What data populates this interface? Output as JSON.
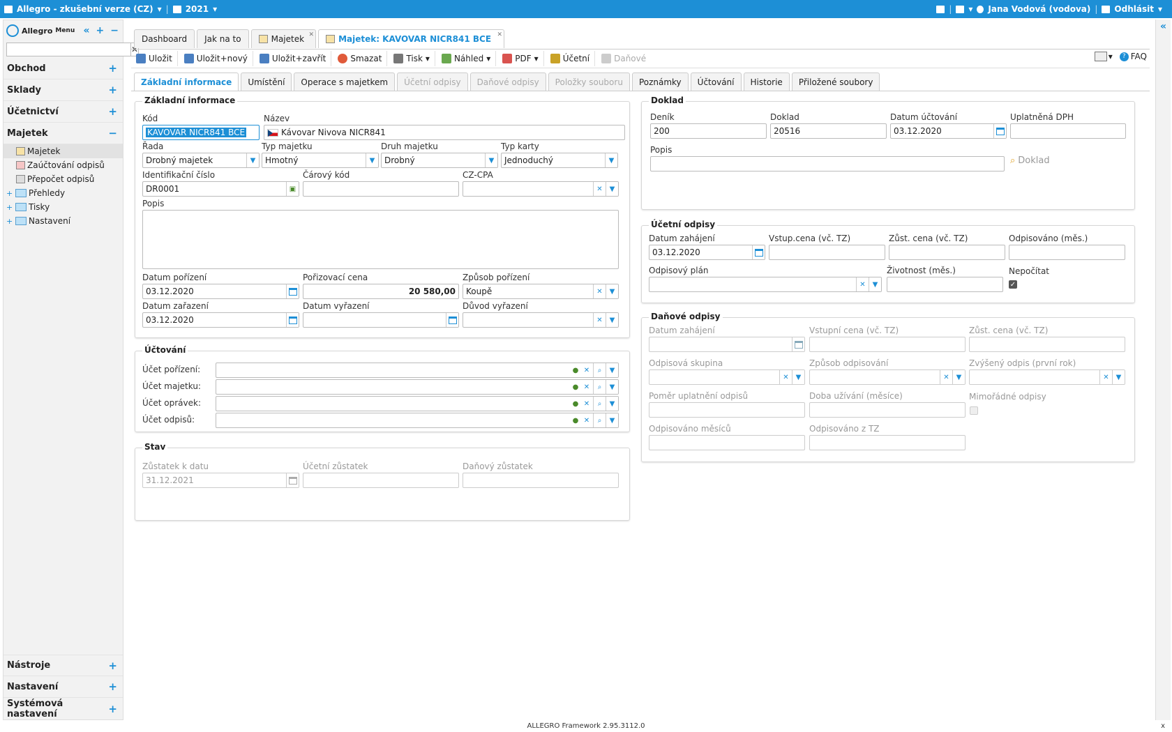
{
  "topbar": {
    "app_title": "Allegro - zkušební verze (CZ)",
    "year": "2021",
    "user": "Jana Vodová (vodova)",
    "logout": "Odhlásit"
  },
  "sidebar": {
    "brand": "Allegro",
    "brand_sub": "Menu",
    "search_placeholder": "",
    "sections": {
      "obchod": "Obchod",
      "sklady": "Sklady",
      "ucetnictvi": "Účetnictví",
      "majetek": "Majetek",
      "nastroje": "Nástroje",
      "nastaveni": "Nastavení",
      "systemova": "Systémová nastavení"
    },
    "items": {
      "majetek": "Majetek",
      "zauctovani": "Zaúčtování odpisů",
      "prepocet": "Přepočet odpisů",
      "prehledy": "Přehledy",
      "tisky": "Tisky",
      "nastaveni": "Nastavení"
    }
  },
  "tabs": {
    "dashboard": "Dashboard",
    "jak": "Jak na to",
    "majetek": "Majetek",
    "detail": "Majetek: KAVOVAR NICR841 BCE"
  },
  "toolbar": {
    "ulozit": "Uložit",
    "ulozit_novy": "Uložit+nový",
    "ulozit_zavrit": "Uložit+zavřít",
    "smazat": "Smazat",
    "tisk": "Tisk",
    "nahled": "Náhled",
    "pdf": "PDF",
    "ucetni": "Účetní",
    "danove": "Daňové",
    "faq": "FAQ"
  },
  "form_tabs": {
    "zakladni": "Základní informace",
    "umisteni": "Umístění",
    "operace": "Operace s majetkem",
    "ucetni_odpisy": "Účetní odpisy",
    "danove_odpisy": "Daňové odpisy",
    "polozky": "Položky souboru",
    "poznamky": "Poznámky",
    "uctovani": "Účtování",
    "historie": "Historie",
    "prilozene": "Přiložené soubory"
  },
  "basic": {
    "legend": "Základní informace",
    "kod_label": "Kód",
    "kod": "KAVOVAR NICR841 BCE",
    "nazev_label": "Název",
    "nazev": "Kávovar Nivova NICR841",
    "rada_label": "Řada",
    "rada": "Drobný majetek",
    "typ_label": "Typ majetku",
    "typ": "Hmotný",
    "druh_label": "Druh majetku",
    "druh": "Drobný",
    "karta_label": "Typ karty",
    "karta": "Jednoduchý",
    "ic_label": "Identifikační číslo",
    "ic": "DR0001",
    "carovy_label": "Čárový kód",
    "carovy": "",
    "cpa_label": "CZ-CPA",
    "cpa": "",
    "popis_label": "Popis",
    "popis": "",
    "datum_por_label": "Datum pořízení",
    "datum_por": "03.12.2020",
    "cena_label": "Pořizovací cena",
    "cena": "20 580,00",
    "zpusob_label": "Způsob pořízení",
    "zpusob": "Koupě",
    "datum_zar_label": "Datum zařazení",
    "datum_zar": "03.12.2020",
    "datum_vyr_label": "Datum vyřazení",
    "datum_vyr": "",
    "duvod_label": "Důvod vyřazení",
    "duvod": ""
  },
  "uctovani": {
    "legend": "Účtování",
    "porizeni": "Účet pořízení:",
    "majetku": "Účet majetku:",
    "opravek": "Účet oprávek:",
    "odpisu": "Účet odpisů:"
  },
  "stav": {
    "legend": "Stav",
    "zustatek_label": "Zůstatek k datu",
    "zustatek": "31.12.2021",
    "ucetni_label": "Účetní zůstatek",
    "danovy_label": "Daňový zůstatek"
  },
  "doklad": {
    "legend": "Doklad",
    "denik_label": "Deník",
    "denik": "200",
    "doklad_label": "Doklad",
    "doklad": "20516",
    "datum_label": "Datum účtování",
    "datum": "03.12.2020",
    "dph_label": "Uplatněná DPH",
    "popis_label": "Popis",
    "doklad_btn": "Doklad"
  },
  "ucetni_odpisy": {
    "legend": "Účetní odpisy",
    "zahajeni_label": "Datum zahájení",
    "zahajeni": "03.12.2020",
    "vstup_label": "Vstup.cena (vč. TZ)",
    "zust_label": "Zůst. cena (vč. TZ)",
    "odpisovano_label": "Odpisováno (měs.)",
    "plan_label": "Odpisový plán",
    "zivotnost_label": "Životnost (měs.)",
    "nepocitat_label": "Nepočítat"
  },
  "danove_odpisy": {
    "legend": "Daňové odpisy",
    "zahajeni_label": "Datum zahájení",
    "vstup_label": "Vstupní cena (vč. TZ)",
    "zust_label": "Zůst. cena (vč. TZ)",
    "skupina_label": "Odpisová skupina",
    "zpusob_label": "Způsob odpisování",
    "zvyseny_label": "Zvýšený odpis (první rok)",
    "pomer_label": "Poměr uplatnění odpisů",
    "doba_label": "Doba užívání (měsíce)",
    "mimoradne_label": "Mimořádné odpisy",
    "mesicu_label": "Odpisováno měsíců",
    "z_tz_label": "Odpisováno z TZ"
  },
  "footer": {
    "version": "ALLEGRO Framework 2.95.3112.0",
    "close": "x"
  }
}
